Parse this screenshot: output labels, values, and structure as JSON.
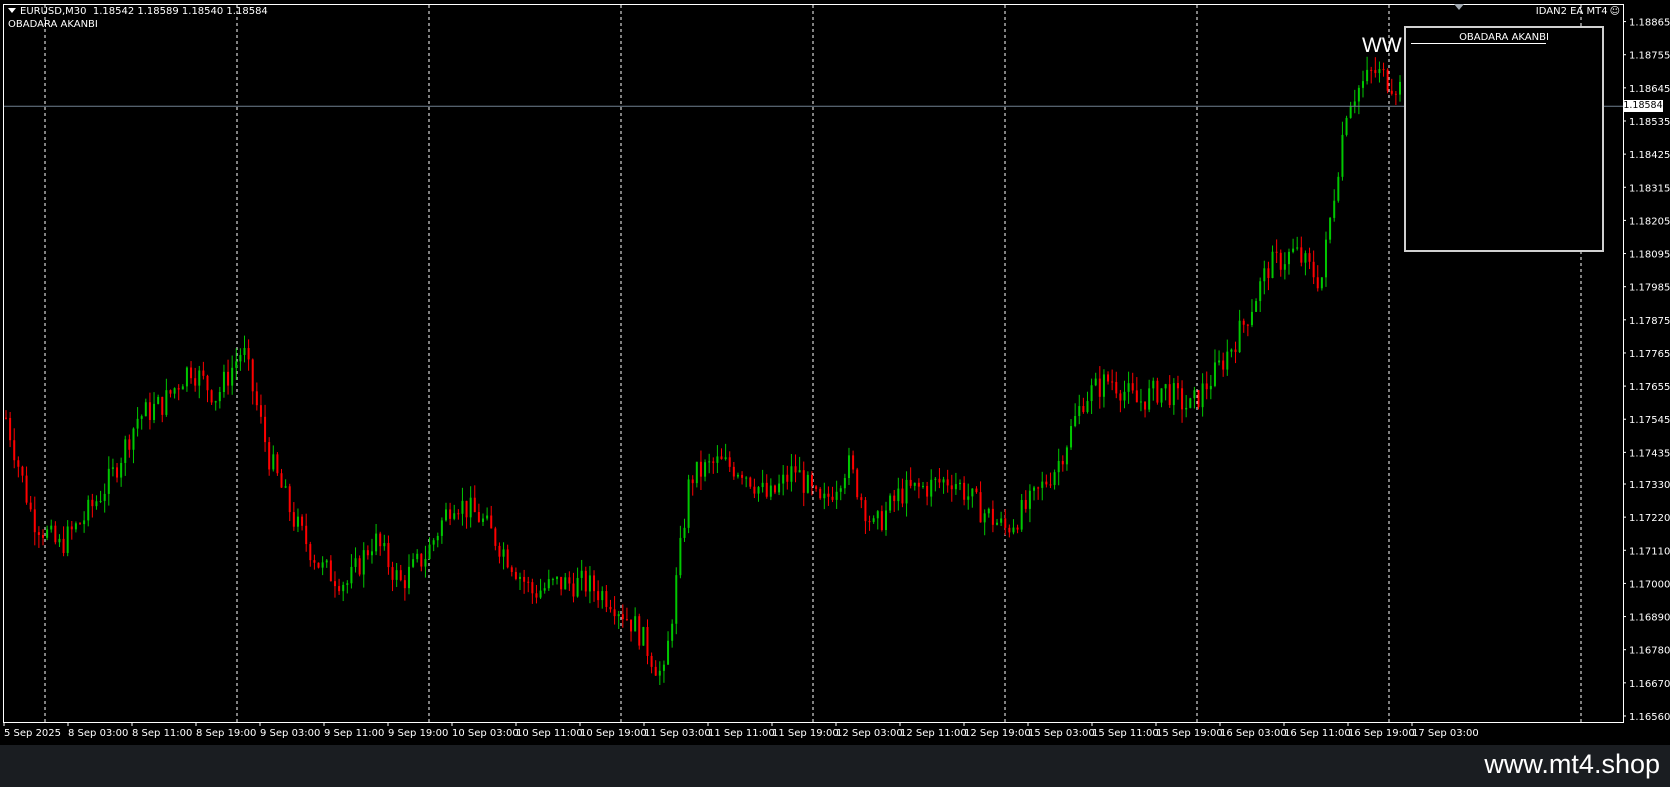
{
  "header": {
    "symbol_info": "EURUSD,M30  1.18542 1.18589 1.18540 1.18584",
    "indicator_name": "OBADARA AKANBI",
    "ea_label": "IDAN2 EA MT4",
    "smiley_icon": "smiley-face-icon"
  },
  "panel": {
    "title": "OBADARA AKANBI",
    "overlay_text": "WW"
  },
  "current_price": "1.18584",
  "watermark": "www.mt4.shop",
  "colors": {
    "background": "#000000",
    "bull_candle": "#00c800",
    "bear_candle": "#ff0000",
    "grid": "#ffffff",
    "price_line": "#708090",
    "footer": "#1a1d21"
  },
  "chart_data": {
    "type": "candlestick",
    "symbol": "EURUSD",
    "timeframe": "M30",
    "ylim": [
      1.1654,
      1.1892
    ],
    "y_ticks": [
      "1.18865",
      "1.18755",
      "1.18645",
      "1.18535",
      "1.18425",
      "1.18315",
      "1.18205",
      "1.18095",
      "1.17985",
      "1.17875",
      "1.17765",
      "1.17655",
      "1.17545",
      "1.17435",
      "1.17330",
      "1.17220",
      "1.17110",
      "1.17000",
      "1.16890",
      "1.16780",
      "1.16670",
      "1.16560"
    ],
    "x_ticks": [
      "5 Sep 2025",
      "8 Sep 03:00",
      "8 Sep 11:00",
      "8 Sep 19:00",
      "9 Sep 03:00",
      "9 Sep 11:00",
      "9 Sep 19:00",
      "10 Sep 03:00",
      "10 Sep 11:00",
      "10 Sep 19:00",
      "11 Sep 03:00",
      "11 Sep 11:00",
      "11 Sep 19:00",
      "12 Sep 03:00",
      "12 Sep 11:00",
      "12 Sep 19:00",
      "15 Sep 03:00",
      "15 Sep 11:00",
      "15 Sep 19:00",
      "16 Sep 03:00",
      "16 Sep 11:00",
      "16 Sep 19:00",
      "17 Sep 03:00"
    ],
    "grid": "vertical dotted at day boundaries",
    "current_price": 1.18584,
    "approx_close_path": [
      1.1755,
      1.1722,
      1.1712,
      1.1722,
      1.1735,
      1.1755,
      1.176,
      1.1772,
      1.1762,
      1.1778,
      1.1742,
      1.172,
      1.1705,
      1.17,
      1.1715,
      1.17,
      1.171,
      1.1728,
      1.1722,
      1.171,
      1.1697,
      1.17,
      1.17,
      1.1695,
      1.1685,
      1.1668,
      1.1735,
      1.174,
      1.1738,
      1.1728,
      1.1738,
      1.1725,
      1.174,
      1.1718,
      1.173,
      1.1732,
      1.1735,
      1.1725,
      1.1718,
      1.1727,
      1.174,
      1.1762,
      1.1768,
      1.176,
      1.1765,
      1.1758,
      1.177,
      1.1785,
      1.1805,
      1.181,
      1.18,
      1.186,
      1.187,
      1.1865
    ]
  }
}
